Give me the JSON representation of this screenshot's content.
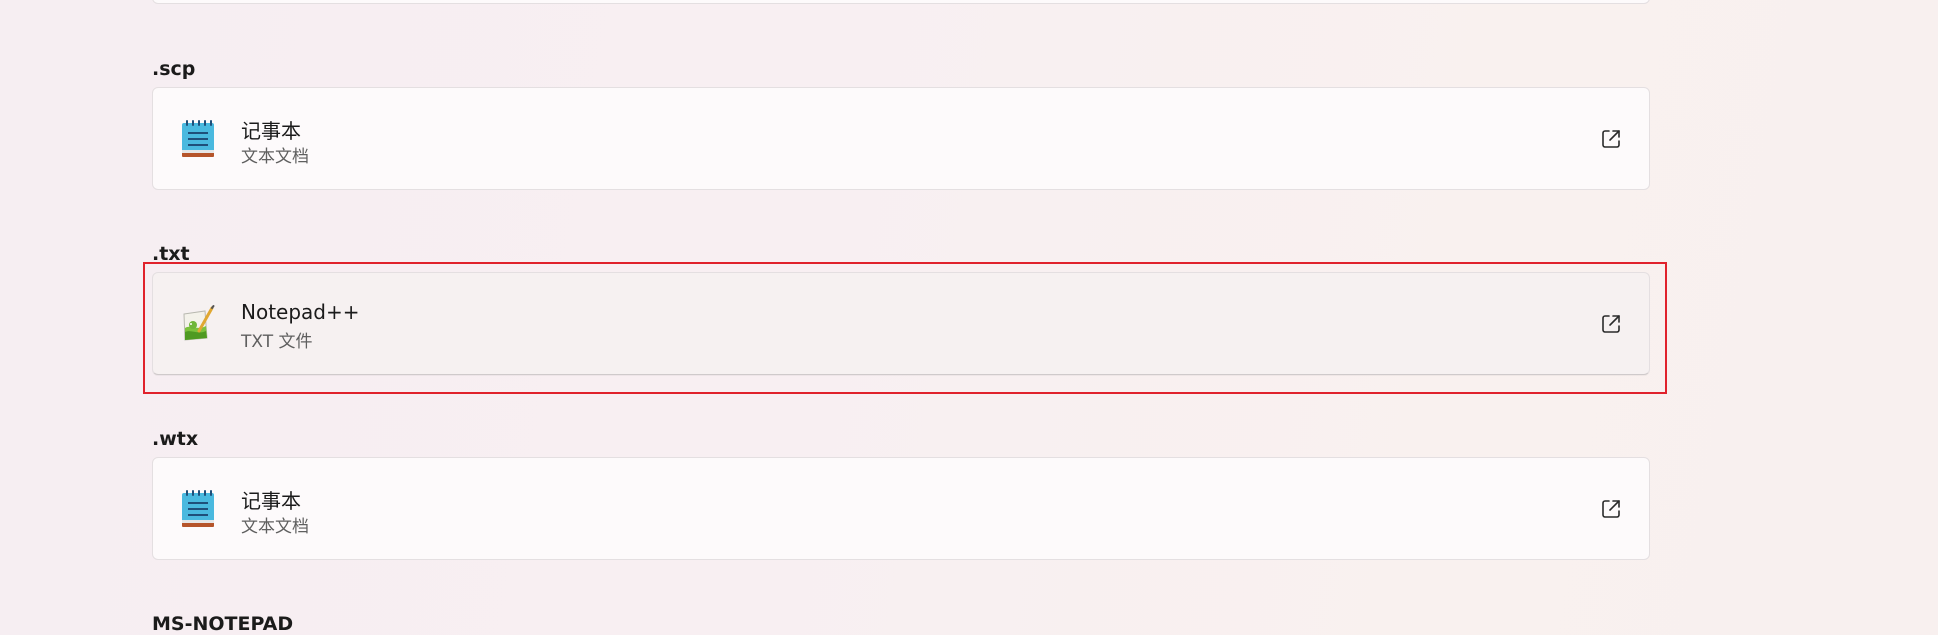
{
  "associations": [
    {
      "extension": ".scp",
      "app_name": "记事本",
      "app_description": "文本文档",
      "app_icon": "notepad-icon"
    },
    {
      "extension": ".txt",
      "app_name": "Notepad++",
      "app_description": "TXT 文件",
      "app_icon": "notepad-plus-plus-icon",
      "highlighted": true
    },
    {
      "extension": ".wtx",
      "app_name": "记事本",
      "app_description": "文本文档",
      "app_icon": "notepad-icon"
    }
  ],
  "next_section": {
    "label": "MS-NOTEPAD"
  },
  "icons": {
    "open_external": "open-external-icon"
  },
  "colors": {
    "highlight_border": "#e0222c",
    "background": "#f7eff1",
    "card": "#fdfbfc"
  }
}
